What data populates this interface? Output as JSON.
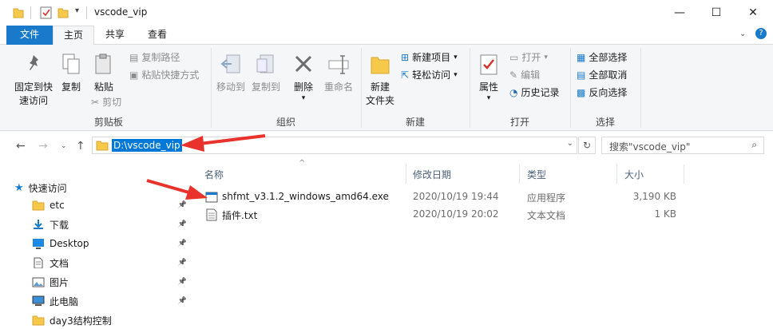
{
  "window": {
    "title": "vscode_vip",
    "minimize_icon": "minimize-icon",
    "maximize_icon": "maximize-icon",
    "close_icon": "close-icon"
  },
  "ribbon_tabs": [
    "文件",
    "主页",
    "共享",
    "查看"
  ],
  "ribbon": {
    "clipboard": {
      "label": "剪贴板",
      "pin_quick": "固定到快\n速访问",
      "copy": "复制",
      "paste": "粘贴",
      "copy_path": "复制路径",
      "paste_shortcut": "粘贴快捷方式",
      "cut": "剪切"
    },
    "organize": {
      "label": "组织",
      "move_to": "移动到",
      "copy_to": "复制到",
      "delete": "删除",
      "rename": "重命名"
    },
    "new": {
      "label": "新建",
      "new_folder": "新建\n文件夹",
      "new_item": "新建项目",
      "easy_access": "轻松访问"
    },
    "open": {
      "label": "打开",
      "properties": "属性",
      "open": "打开",
      "edit": "编辑",
      "history": "历史记录"
    },
    "select": {
      "label": "选择",
      "select_all": "全部选择",
      "select_none": "全部取消",
      "invert": "反向选择"
    }
  },
  "address": {
    "path": "D:\\vscode_vip",
    "search_placeholder": "搜索\"vscode_vip\""
  },
  "nav_pane": {
    "quick_access": "快速访问",
    "items": [
      {
        "label": "etc",
        "icon": "folder-icon",
        "pinned": true
      },
      {
        "label": "下载",
        "icon": "download-icon",
        "pinned": true
      },
      {
        "label": "Desktop",
        "icon": "desktop-icon",
        "pinned": true
      },
      {
        "label": "文档",
        "icon": "document-icon",
        "pinned": true
      },
      {
        "label": "图片",
        "icon": "picture-icon",
        "pinned": true
      },
      {
        "label": "此电脑",
        "icon": "computer-icon",
        "pinned": true
      },
      {
        "label": "day3结构控制",
        "icon": "folder-icon",
        "pinned": false
      }
    ]
  },
  "file_list": {
    "columns": [
      "名称",
      "修改日期",
      "类型",
      "大小"
    ],
    "rows": [
      {
        "name": "shfmt_v3.1.2_windows_amd64.exe",
        "modified": "2020/10/19 19:44",
        "type": "应用程序",
        "size": "3,190 KB",
        "icon": "exe-icon"
      },
      {
        "name": "插件.txt",
        "modified": "2020/10/19 20:02",
        "type": "文本文档",
        "size": "1 KB",
        "icon": "txt-icon"
      }
    ]
  },
  "colors": {
    "accent": "#1979ca",
    "selection": "#0078d7",
    "annotation_arrow": "#e8322b",
    "folder": "#f6c94a"
  }
}
